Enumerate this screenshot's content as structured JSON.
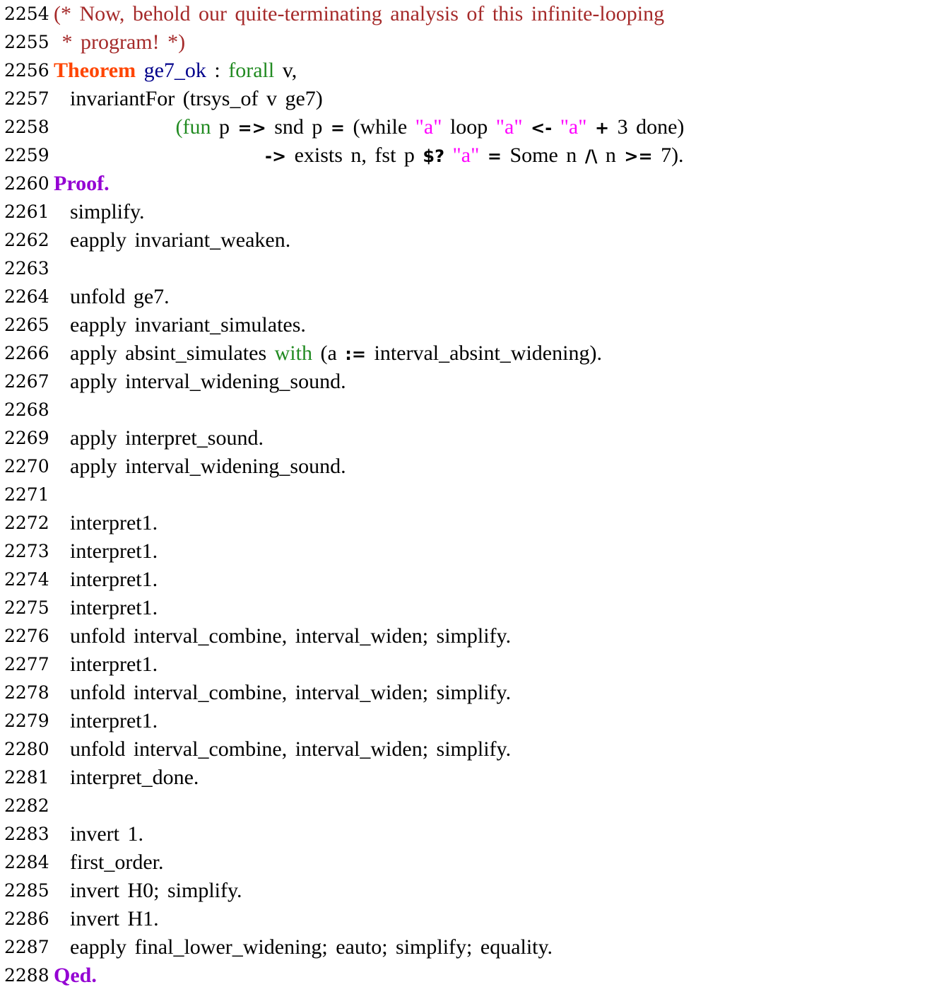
{
  "colors": {
    "comment": "#a52a2a",
    "vernacular_keyword": "#ff4500",
    "proof_keyword": "#9400d3",
    "definition_name": "#00008b",
    "gallina_keyword": "#228b22",
    "string": "#ff00ff",
    "text": "#000000",
    "background": "#ffffff"
  },
  "lines": [
    {
      "n": "2254",
      "tokens": [
        {
          "t": "(* Now, behold our quite-terminating analysis of this infinite-looping",
          "c": "cm"
        }
      ]
    },
    {
      "n": "2255",
      "tokens": [
        {
          "t": " * program! *)",
          "c": "cm"
        }
      ]
    },
    {
      "n": "2256",
      "tokens": [
        {
          "t": "Theorem",
          "c": "kwo"
        },
        {
          "t": " "
        },
        {
          "t": "ge7_ok",
          "c": "id"
        },
        {
          "t": " : "
        },
        {
          "t": "forall",
          "c": "kwg"
        },
        {
          "t": " v,"
        }
      ]
    },
    {
      "n": "2257",
      "tokens": [
        {
          "t": "  invariantFor (trsys_of v ge7)"
        }
      ]
    },
    {
      "n": "2258",
      "tokens": [
        {
          "t": "               "
        },
        {
          "t": "(fun",
          "c": "kwg"
        },
        {
          "t": " p "
        },
        {
          "t": "=>",
          "c": "op"
        },
        {
          "t": " snd p "
        },
        {
          "t": "=",
          "c": "op"
        },
        {
          "t": " (while "
        },
        {
          "t": "\"a\"",
          "c": "str"
        },
        {
          "t": " loop "
        },
        {
          "t": "\"a\"",
          "c": "str"
        },
        {
          "t": " "
        },
        {
          "t": "<-",
          "c": "op"
        },
        {
          "t": " "
        },
        {
          "t": "\"a\"",
          "c": "str"
        },
        {
          "t": " "
        },
        {
          "t": "+",
          "c": "op"
        },
        {
          "t": " 3 done)"
        }
      ]
    },
    {
      "n": "2259",
      "tokens": [
        {
          "t": "                          "
        },
        {
          "t": "->",
          "c": "op"
        },
        {
          "t": " exists n, fst p "
        },
        {
          "t": "$?",
          "c": "op"
        },
        {
          "t": " "
        },
        {
          "t": "\"a\"",
          "c": "str"
        },
        {
          "t": " "
        },
        {
          "t": "=",
          "c": "op"
        },
        {
          "t": " Some n "
        },
        {
          "t": "/\\",
          "c": "op"
        },
        {
          "t": " n "
        },
        {
          "t": ">=",
          "c": "op"
        },
        {
          "t": " 7)."
        }
      ]
    },
    {
      "n": "2260",
      "tokens": [
        {
          "t": "Proof.",
          "c": "kwp"
        }
      ]
    },
    {
      "n": "2261",
      "tokens": [
        {
          "t": "  simplify."
        }
      ]
    },
    {
      "n": "2262",
      "tokens": [
        {
          "t": "  eapply invariant_weaken."
        }
      ]
    },
    {
      "n": "2263",
      "tokens": []
    },
    {
      "n": "2264",
      "tokens": [
        {
          "t": "  unfold ge7."
        }
      ]
    },
    {
      "n": "2265",
      "tokens": [
        {
          "t": "  eapply invariant_simulates."
        }
      ]
    },
    {
      "n": "2266",
      "tokens": [
        {
          "t": "  apply absint_simulates "
        },
        {
          "t": "with",
          "c": "kwg"
        },
        {
          "t": " (a "
        },
        {
          "t": ":=",
          "c": "op"
        },
        {
          "t": " interval_absint_widening)."
        }
      ]
    },
    {
      "n": "2267",
      "tokens": [
        {
          "t": "  apply interval_widening_sound."
        }
      ]
    },
    {
      "n": "2268",
      "tokens": []
    },
    {
      "n": "2269",
      "tokens": [
        {
          "t": "  apply interpret_sound."
        }
      ]
    },
    {
      "n": "2270",
      "tokens": [
        {
          "t": "  apply interval_widening_sound."
        }
      ]
    },
    {
      "n": "2271",
      "tokens": []
    },
    {
      "n": "2272",
      "tokens": [
        {
          "t": "  interpret1."
        }
      ]
    },
    {
      "n": "2273",
      "tokens": [
        {
          "t": "  interpret1."
        }
      ]
    },
    {
      "n": "2274",
      "tokens": [
        {
          "t": "  interpret1."
        }
      ]
    },
    {
      "n": "2275",
      "tokens": [
        {
          "t": "  interpret1."
        }
      ]
    },
    {
      "n": "2276",
      "tokens": [
        {
          "t": "  unfold interval_combine, interval_widen; simplify."
        }
      ]
    },
    {
      "n": "2277",
      "tokens": [
        {
          "t": "  interpret1."
        }
      ]
    },
    {
      "n": "2278",
      "tokens": [
        {
          "t": "  unfold interval_combine, interval_widen; simplify."
        }
      ]
    },
    {
      "n": "2279",
      "tokens": [
        {
          "t": "  interpret1."
        }
      ]
    },
    {
      "n": "2280",
      "tokens": [
        {
          "t": "  unfold interval_combine, interval_widen; simplify."
        }
      ]
    },
    {
      "n": "2281",
      "tokens": [
        {
          "t": "  interpret_done."
        }
      ]
    },
    {
      "n": "2282",
      "tokens": []
    },
    {
      "n": "2283",
      "tokens": [
        {
          "t": "  invert 1."
        }
      ]
    },
    {
      "n": "2284",
      "tokens": [
        {
          "t": "  first_order."
        }
      ]
    },
    {
      "n": "2285",
      "tokens": [
        {
          "t": "  invert H0; simplify."
        }
      ]
    },
    {
      "n": "2286",
      "tokens": [
        {
          "t": "  invert H1."
        }
      ]
    },
    {
      "n": "2287",
      "tokens": [
        {
          "t": "  eapply final_lower_widening; eauto; simplify; equality."
        }
      ]
    },
    {
      "n": "2288",
      "tokens": [
        {
          "t": "Qed.",
          "c": "kwp"
        }
      ]
    }
  ]
}
